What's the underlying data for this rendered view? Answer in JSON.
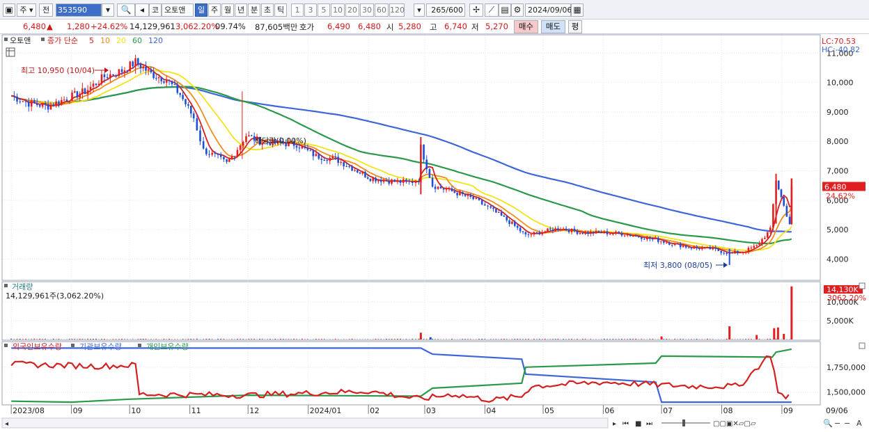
{
  "toolbar": {
    "market_label": "주",
    "period_label": "전",
    "stock_code": "353590",
    "market_badge": "코",
    "stock_name": "오토앤",
    "intervals": [
      "일",
      "주",
      "월",
      "년",
      "분",
      "초",
      "틱"
    ],
    "selected_interval": "일",
    "multipliers": [
      "1",
      "3",
      "5",
      "10",
      "20",
      "30",
      "60",
      "120"
    ],
    "count": "265",
    "count_total": "/600",
    "date": "2024/09/06"
  },
  "quote": {
    "price": "6,480",
    "arrow": "▲",
    "change": "1,280",
    "change_pct": "+24.62%",
    "volume": "14,129,961",
    "volume_pct": "3,062.20%",
    "turnover_pct": "09.74%",
    "amount": "87,605백만",
    "bid_label": "호가",
    "bid": "6,490",
    "ask": "6,480",
    "open_label": "시",
    "open": "5,280",
    "high_label": "고",
    "high": "6,740",
    "low_label": "저",
    "low": "5,270",
    "buy_label": "매수",
    "sell_label": "매도",
    "eval_label": "평"
  },
  "price_panel": {
    "legend_name": "오토앤",
    "legend_ma": "종가 단순",
    "ma_periods": [
      "5",
      "10",
      "20",
      "60",
      "120"
    ],
    "ma_colors": [
      "#d42020",
      "#f08c1a",
      "#f3e316",
      "#2a9a4a",
      "#3f66d8"
    ],
    "lc_text": "LC:70.53",
    "hc_text": "HC:-40.82",
    "high_annotation": "최고 10,950 (10/04)",
    "low_annotation": "최저 3,800 (08/05)",
    "dividend_annotation": "배당락(0.00%)",
    "last_price_tag": "6,480",
    "last_change_tag": "24.62%"
  },
  "volume_panel": {
    "title": "거래량",
    "info": "14,129,961주(3,062.20%)",
    "tag_value": "14,130K",
    "tag_pct": "3062.20%"
  },
  "holdings_panel": {
    "legend": [
      "외국인보유수량",
      "기관보유수량",
      "개인보유수량"
    ],
    "colors": [
      "#d42020",
      "#3f66d8",
      "#2a9a4a"
    ]
  },
  "chart_data": [
    {
      "type": "candlestick",
      "title": "오토앤 일봉",
      "x": [
        "2023/08",
        "09",
        "10",
        "11",
        "12",
        "2024/01",
        "02",
        "03",
        "04",
        "05",
        "06",
        "07",
        "08",
        "09"
      ],
      "x_dates": [
        "2023-08",
        "2023-09",
        "2023-10",
        "2023-11",
        "2023-12",
        "2024-01",
        "2024-02",
        "2024-03",
        "2024-04",
        "2024-05",
        "2024-06",
        "2024-07",
        "2024-08",
        "2024-09"
      ],
      "y_ticks": [
        4000,
        5000,
        6000,
        7000,
        8000,
        9000,
        10000,
        11000
      ],
      "ylim": [
        3300,
        11600
      ],
      "close_series": [
        [
          "2023-08-01",
          9550
        ],
        [
          "2023-08-10",
          9300
        ],
        [
          "2023-08-20",
          9200
        ],
        [
          "2023-08-31",
          9500
        ],
        [
          "2023-09-08",
          9700
        ],
        [
          "2023-09-18",
          10200
        ],
        [
          "2023-09-27",
          10400
        ],
        [
          "2023-10-04",
          10700
        ],
        [
          "2023-10-12",
          10300
        ],
        [
          "2023-10-20",
          10100
        ],
        [
          "2023-10-27",
          9600
        ],
        [
          "2023-11-03",
          8800
        ],
        [
          "2023-11-08",
          7700
        ],
        [
          "2023-11-14",
          7500
        ],
        [
          "2023-11-20",
          7250
        ],
        [
          "2023-11-24",
          7600
        ],
        [
          "2023-11-30",
          8200
        ],
        [
          "2023-12-07",
          8000
        ],
        [
          "2023-12-15",
          7950
        ],
        [
          "2023-12-26",
          7900
        ],
        [
          "2024-01-05",
          7500
        ],
        [
          "2024-01-15",
          7400
        ],
        [
          "2024-01-25",
          7050
        ],
        [
          "2024-02-02",
          6750
        ],
        [
          "2024-02-13",
          6650
        ],
        [
          "2024-02-22",
          6600
        ],
        [
          "2024-02-27",
          6700
        ],
        [
          "2024-02-28",
          7800
        ],
        [
          "2024-03-05",
          6500
        ],
        [
          "2024-03-15",
          6300
        ],
        [
          "2024-03-26",
          6050
        ],
        [
          "2024-04-04",
          5700
        ],
        [
          "2024-04-15",
          5200
        ],
        [
          "2024-04-22",
          4800
        ],
        [
          "2024-05-02",
          4950
        ],
        [
          "2024-05-10",
          5050
        ],
        [
          "2024-05-20",
          4900
        ],
        [
          "2024-05-31",
          4900
        ],
        [
          "2024-06-12",
          4850
        ],
        [
          "2024-06-25",
          4700
        ],
        [
          "2024-07-05",
          4550
        ],
        [
          "2024-07-15",
          4400
        ],
        [
          "2024-07-26",
          4350
        ],
        [
          "2024-08-05",
          4200
        ],
        [
          "2024-08-12",
          4250
        ],
        [
          "2024-08-19",
          4450
        ],
        [
          "2024-08-26",
          5000
        ],
        [
          "2024-08-29",
          6700
        ],
        [
          "2024-09-02",
          5800
        ],
        [
          "2024-09-05",
          5200
        ],
        [
          "2024-09-06",
          6480
        ]
      ],
      "high": {
        "value": 10950,
        "date": "10/04"
      },
      "low": {
        "value": 3800,
        "date": "08/05"
      },
      "last": 6480
    },
    {
      "type": "bar",
      "title": "거래량",
      "y_ticks": [
        5000,
        10000
      ],
      "y_unit": "K",
      "spikes": [
        [
          "2024-02-28",
          1800
        ],
        [
          "2024-03-04",
          600
        ],
        [
          "2024-07-01",
          800
        ],
        [
          "2024-08-05",
          3500
        ],
        [
          "2024-08-19",
          1200
        ],
        [
          "2024-08-28",
          3000
        ],
        [
          "2024-08-30",
          3200
        ],
        [
          "2024-09-02",
          1500
        ],
        [
          "2024-09-06",
          14130
        ]
      ],
      "last": 14130
    },
    {
      "type": "line",
      "title": "보유수량",
      "y_ticks": [
        1500000,
        1750000
      ],
      "series": [
        {
          "name": "외국인보유수량",
          "values_note": "red line"
        },
        {
          "name": "기관보유수량"
        },
        {
          "name": "개인보유수량"
        }
      ]
    }
  ]
}
